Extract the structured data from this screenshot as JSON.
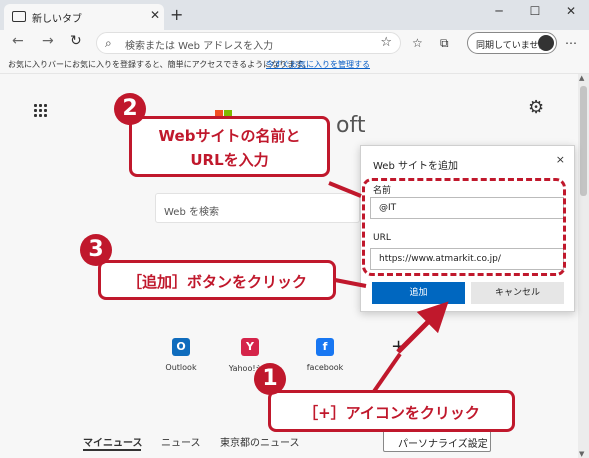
{
  "tab": {
    "title": "新しいタブ",
    "close": "✕"
  },
  "window": {
    "minimize": "─",
    "maximize": "☐",
    "close": "✕"
  },
  "nav": {
    "back": "←",
    "forward": "→",
    "refresh": "↻"
  },
  "address": {
    "placeholder": "検索または Web アドレスを入力"
  },
  "sync": {
    "label": "同期していません"
  },
  "favbar": {
    "message": "お気に入りバーにお気に入りを登録すると、簡単にアクセスできるようになります。",
    "link": "今すぐお気に入りを管理する"
  },
  "newtab": {
    "search_placeholder": "Web を検索",
    "logo_text_partial": "oft",
    "tiles": [
      {
        "label": "Outlook",
        "icon": "outlook-icon",
        "color": "#0f6cbd",
        "glyph": "O"
      },
      {
        "label": "Yahoo!シ...",
        "icon": "yahoo-shopping-icon",
        "color": "#d5244a",
        "glyph": "Y"
      },
      {
        "label": "facebook",
        "icon": "facebook-icon",
        "color": "#1877f2",
        "glyph": "f"
      }
    ],
    "add_tile": "+",
    "news_tabs": [
      "マイニュース",
      "ニュース",
      "東京都のニュース"
    ],
    "personalize": "パーソナライズ設定"
  },
  "dialog": {
    "title": "Web サイトを追加",
    "name_label": "名前",
    "name_value": "@IT",
    "url_label": "URL",
    "url_value": "https://www.atmarkit.co.jp/",
    "add_button": "追加",
    "cancel_button": "キャンセル",
    "close": "×"
  },
  "annotations": {
    "step1_number": "1",
    "step1_text": "［+］アイコンをクリック",
    "step2_number": "2",
    "step2_line1": "Webサイトの名前と",
    "step2_line2": "URLを入力",
    "step3_number": "3",
    "step3_text": "［追加］ボタンをクリック",
    "accent_color": "#c0182c"
  }
}
